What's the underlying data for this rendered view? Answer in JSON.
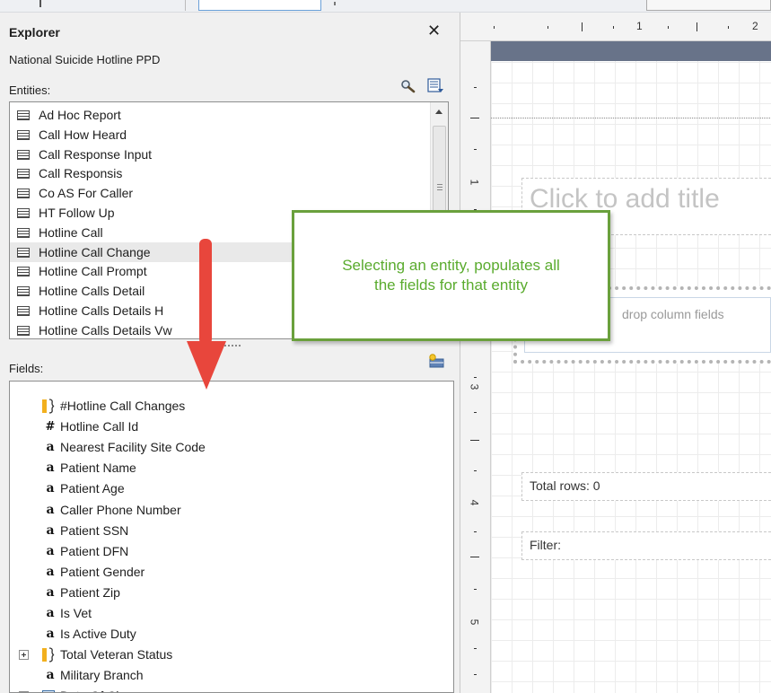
{
  "explorer": {
    "title": "Explorer",
    "close_glyph": "✕",
    "project_name": "National Suicide Hotline PPD",
    "entities_label": "Entities:",
    "fields_label": "Fields:",
    "icons": {
      "search": "magnifier-search-icon",
      "list": "entity-list-options-icon",
      "add_field": "add-field-icon"
    },
    "entities": [
      {
        "label": "Ad Hoc Report",
        "selected": false
      },
      {
        "label": "Call How Heard",
        "selected": false
      },
      {
        "label": "Call Response Input",
        "selected": false
      },
      {
        "label": "Call Responsis",
        "selected": false
      },
      {
        "label": "Co AS For Caller",
        "selected": false
      },
      {
        "label": "HT Follow Up",
        "selected": false
      },
      {
        "label": "Hotline Call",
        "selected": false
      },
      {
        "label": "Hotline Call Change",
        "selected": true
      },
      {
        "label": "Hotline Call Prompt",
        "selected": false
      },
      {
        "label": "Hotline Calls Detail",
        "selected": false
      },
      {
        "label": "Hotline Calls Details H",
        "selected": false
      },
      {
        "label": "Hotline Calls Details Vw",
        "selected": false
      }
    ],
    "fields": [
      {
        "label": "#Hotline Call Changes",
        "type": "aggregate",
        "expandable": false
      },
      {
        "label": "Hotline Call Id",
        "type": "number",
        "expandable": false
      },
      {
        "label": "Nearest Facility Site Code",
        "type": "text",
        "expandable": false
      },
      {
        "label": "Patient Name",
        "type": "text",
        "expandable": false
      },
      {
        "label": "Patient Age",
        "type": "text",
        "expandable": false
      },
      {
        "label": "Caller Phone Number",
        "type": "text",
        "expandable": false
      },
      {
        "label": "Patient SSN",
        "type": "text",
        "expandable": false
      },
      {
        "label": "Patient DFN",
        "type": "text",
        "expandable": false
      },
      {
        "label": "Patient Gender",
        "type": "text",
        "expandable": false
      },
      {
        "label": "Patient Zip",
        "type": "text",
        "expandable": false
      },
      {
        "label": "Is Vet",
        "type": "text",
        "expandable": false
      },
      {
        "label": "Is Active Duty",
        "type": "text",
        "expandable": false
      },
      {
        "label": "Total Veteran Status",
        "type": "aggregate",
        "expandable": true
      },
      {
        "label": "Military Branch",
        "type": "text",
        "expandable": false
      },
      {
        "label": "Date Of Change",
        "type": "date",
        "expandable": true
      }
    ]
  },
  "designer": {
    "ruler_h_numbers": [
      "1",
      "2"
    ],
    "ruler_v_numbers": [
      "1",
      "3",
      "4",
      "5"
    ],
    "title_placeholder": "Click to add title",
    "table_placeholder": "drop column fields",
    "total_rows": "Total rows: 0",
    "filter": "Filter:",
    "band_color": "#687389"
  },
  "callout": {
    "text_line1": "Selecting an entity, populates all",
    "text_line2": "the fields for that entity",
    "border_color": "#6aa03c",
    "text_color": "#5aab2e"
  },
  "arrow": {
    "color": "#e8463c",
    "direction": "down"
  }
}
